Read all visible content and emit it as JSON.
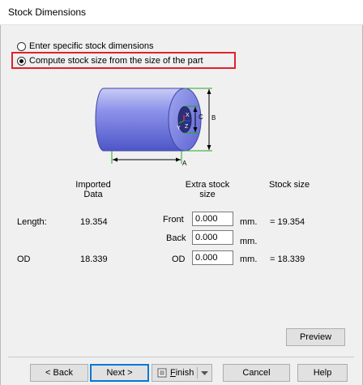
{
  "window": {
    "title": "Stock Dimensions"
  },
  "options": {
    "specific": {
      "label": "Enter specific stock dimensions",
      "checked": false
    },
    "compute": {
      "label": "Compute stock size from the size of the part",
      "checked": true
    }
  },
  "diagram": {
    "label_a": "A",
    "label_b": "B",
    "label_c": "C",
    "axis_x": "X",
    "axis_y": "Y",
    "axis_z": "Z"
  },
  "columns": {
    "imported_1": "Imported",
    "imported_2": "Data",
    "extra_1": "Extra stock",
    "extra_2": "size",
    "stock": "Stock size"
  },
  "rows": {
    "length": {
      "label": "Length:",
      "imported": "19.354",
      "front_label": "Front",
      "front_value": "0.000",
      "back_label": "Back",
      "back_value": "0.000",
      "unit": "mm.",
      "stock": "= 19.354"
    },
    "od": {
      "label": "OD",
      "imported": "18.339",
      "od_label": "OD",
      "od_value": "0.000",
      "unit": "mm.",
      "stock": "= 18.339"
    }
  },
  "buttons": {
    "preview": "Preview",
    "back": "< Back",
    "next": "Next >",
    "finish_f": "F",
    "finish_rest": "inish",
    "cancel": "Cancel",
    "help": "Help"
  },
  "colors": {
    "highlight": "#e0212b",
    "cylinder": "#7b83e6",
    "dimension": "#1faa1f"
  }
}
